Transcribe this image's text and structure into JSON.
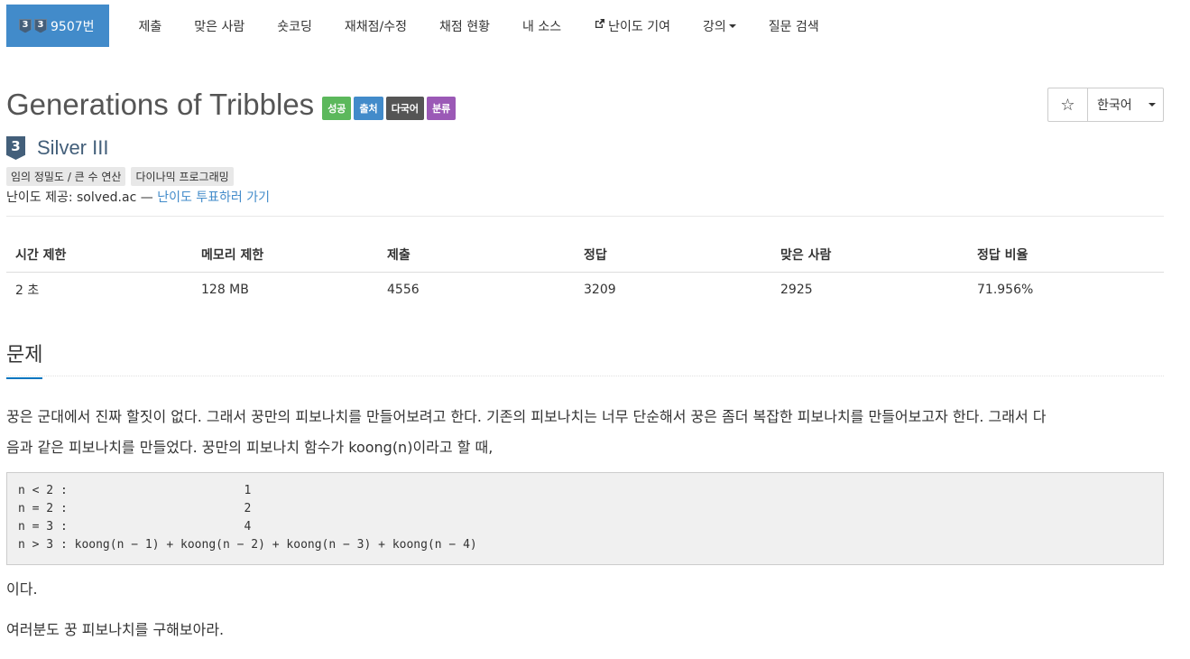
{
  "nav": {
    "problem_tier": "3",
    "problem_id_tier": "3",
    "problem_number": "9507번",
    "items": [
      "제출",
      "맞은 사람",
      "숏코딩",
      "재채점/수정",
      "채점 현황",
      "내 소스",
      "난이도 기여",
      "강의",
      "질문 검색"
    ]
  },
  "problem": {
    "title": "Generations of Tribbles",
    "labels": [
      "성공",
      "출처",
      "다국어",
      "분류"
    ],
    "tier_num": "3",
    "tier_text": "Silver III",
    "tags": [
      "임의 정밀도 / 큰 수 연산",
      "다이나믹 프로그래밍"
    ],
    "credit_prefix": "난이도 제공: solved.ac — ",
    "credit_link": "난이도 투표하러 가기"
  },
  "controls": {
    "star": "☆",
    "language": "한국어"
  },
  "stats": {
    "headers": [
      "시간 제한",
      "메모리 제한",
      "제출",
      "정답",
      "맞은 사람",
      "정답 비율"
    ],
    "values": [
      "2 초",
      "128 MB",
      "4556",
      "3209",
      "2925",
      "71.956%"
    ]
  },
  "section": {
    "title": "문제"
  },
  "body": {
    "para1_line1": "꿍은 군대에서 진짜 할짓이 없다. 그래서 꿍만의 피보나치를 만들어보려고 한다. 기존의 피보나치는 너무 단순해서 꿍은 좀더 복잡한 피보나치를 만들어보고자 한다. 그래서 다",
    "para1_line2": "음과 같은 피보나치를 만들었다. 꿍만의 피보나치 함수가 koong(n)이라고 할 때,",
    "code": "n < 2 :                         1\nn = 2 :                         2\nn = 3 :                         4\nn > 3 : koong(n − 1) + koong(n − 2) + koong(n − 3) + koong(n − 4)",
    "para2": "이다.",
    "para3": "여러분도 꿍 피보나치를 구해보아라."
  }
}
